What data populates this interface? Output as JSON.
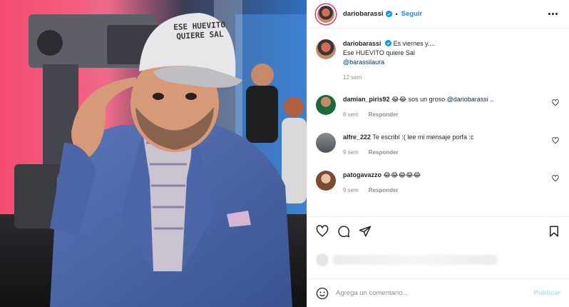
{
  "post": {
    "username": "dariobarassi",
    "follow_label": "Seguir",
    "separator": "•",
    "cap_text": "ESE HUEVITO QUIERE SAL",
    "avatar_icon": "profile-avatar"
  },
  "caption": {
    "username": "dariobarassi",
    "line1": "Es viernes y....",
    "line2": "Ese HUEVITO quiere Sal",
    "mention": "@barassilaura",
    "time": "12 sem"
  },
  "comments": [
    {
      "username": "damian_piris92",
      "emoji": "😂😂",
      "text": " sos un groso ",
      "mention": "@dariobarassi",
      "suffix": " ..",
      "time": "8 sem",
      "reply_label": "Responder"
    },
    {
      "username": "alfre_222",
      "emoji": "",
      "text": "Te escribí :( lee mi mensaje porfa :c",
      "mention": "",
      "suffix": "",
      "time": "9 sem",
      "reply_label": "Responder"
    },
    {
      "username": "patogavazzo",
      "emoji": "😂😂😂😂😂",
      "text": "",
      "mention": "",
      "suffix": "",
      "time": "9 sem",
      "reply_label": "Responder"
    }
  ],
  "composer": {
    "placeholder": "Agrega un comentario...",
    "publish_label": "Publicar"
  },
  "colors": {
    "accent": "#0095f6",
    "publish_disabled": "#b2dffc",
    "muted": "#8e8e8e"
  }
}
